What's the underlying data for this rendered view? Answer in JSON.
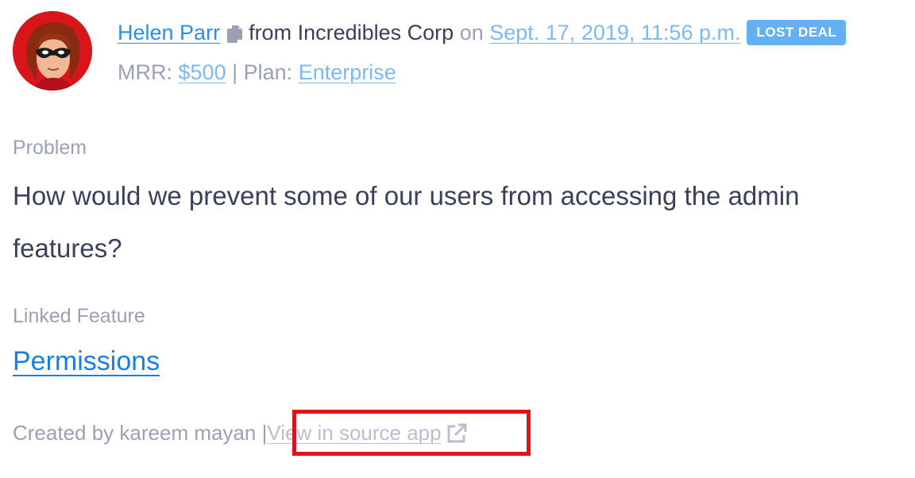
{
  "header": {
    "customer_name": "Helen Parr",
    "from_text": "from",
    "company": "Incredibles Corp",
    "on_text": "on",
    "date": "Sept. 17, 2019, 11:56 p.m.",
    "badge": "LOST DEAL",
    "mrr_label": "MRR:",
    "mrr_value": "$500",
    "separator": "|",
    "plan_label": "Plan:",
    "plan_value": "Enterprise"
  },
  "problem": {
    "label": "Problem",
    "text": "How would we prevent some of our users from accessing the admin features?"
  },
  "linked_feature": {
    "label": "Linked Feature",
    "value": "Permissions"
  },
  "footer": {
    "created_by": "Created by kareem mayan",
    "separator": "|",
    "source_link": "View in source app"
  },
  "icons": {
    "copy": "copy-icon",
    "external": "external-link-icon",
    "avatar": "avatar"
  },
  "colors": {
    "link": "#2d8cf0",
    "badge_bg": "#64b0f0",
    "muted_text": "#9aa1b3",
    "body_text": "#3a3f5c",
    "highlight": "#e0121b"
  }
}
